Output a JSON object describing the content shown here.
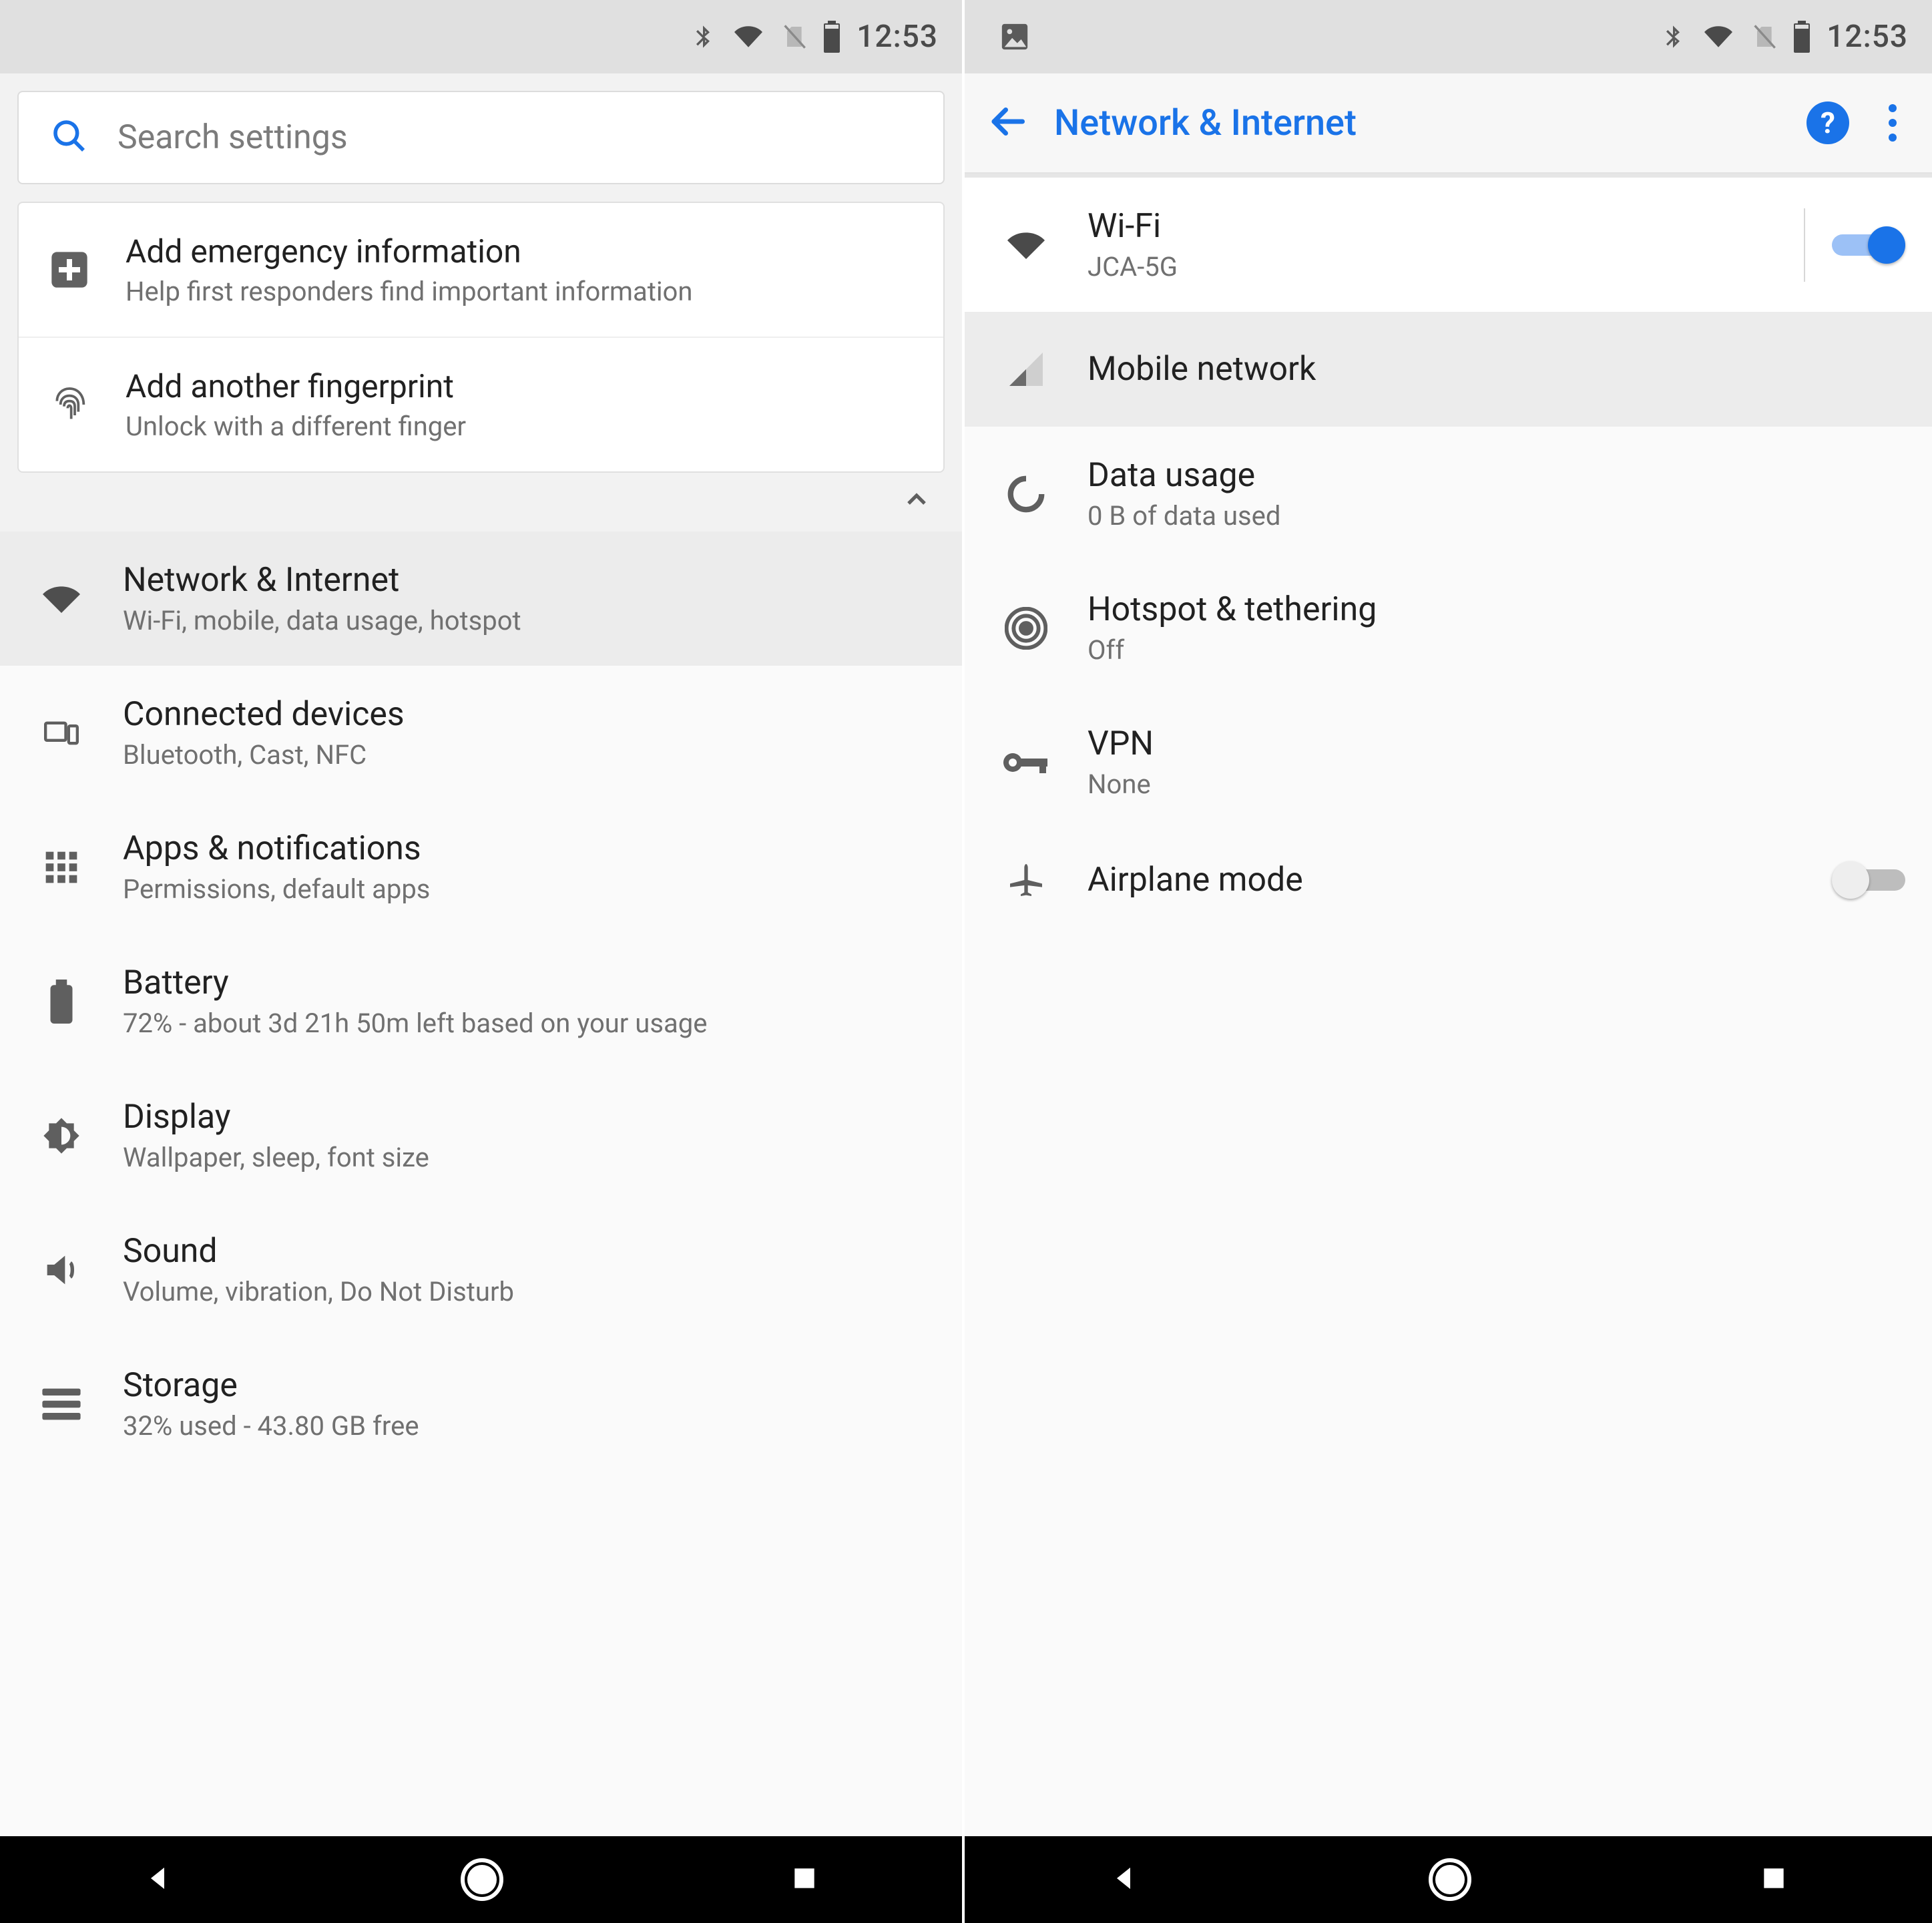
{
  "status": {
    "time": "12:53"
  },
  "left": {
    "search_placeholder": "Search settings",
    "suggestions": [
      {
        "title": "Add emergency information",
        "subtitle": "Help first responders find important information"
      },
      {
        "title": "Add another fingerprint",
        "subtitle": "Unlock with a different finger"
      }
    ],
    "items": [
      {
        "title": "Network & Internet",
        "subtitle": "Wi-Fi, mobile, data usage, hotspot"
      },
      {
        "title": "Connected devices",
        "subtitle": "Bluetooth, Cast, NFC"
      },
      {
        "title": "Apps & notifications",
        "subtitle": "Permissions, default apps"
      },
      {
        "title": "Battery",
        "subtitle": "72% - about 3d 21h 50m left based on your usage"
      },
      {
        "title": "Display",
        "subtitle": "Wallpaper, sleep, font size"
      },
      {
        "title": "Sound",
        "subtitle": "Volume, vibration, Do Not Disturb"
      },
      {
        "title": "Storage",
        "subtitle": "32% used - 43.80 GB free"
      }
    ]
  },
  "right": {
    "title": "Network & Internet",
    "items": [
      {
        "title": "Wi-Fi",
        "subtitle": "JCA-5G",
        "toggle": "on"
      },
      {
        "title": "Mobile network"
      },
      {
        "title": "Data usage",
        "subtitle": "0 B of data used"
      },
      {
        "title": "Hotspot & tethering",
        "subtitle": "Off"
      },
      {
        "title": "VPN",
        "subtitle": "None"
      },
      {
        "title": "Airplane mode",
        "toggle": "off"
      }
    ],
    "help_label": "?"
  }
}
